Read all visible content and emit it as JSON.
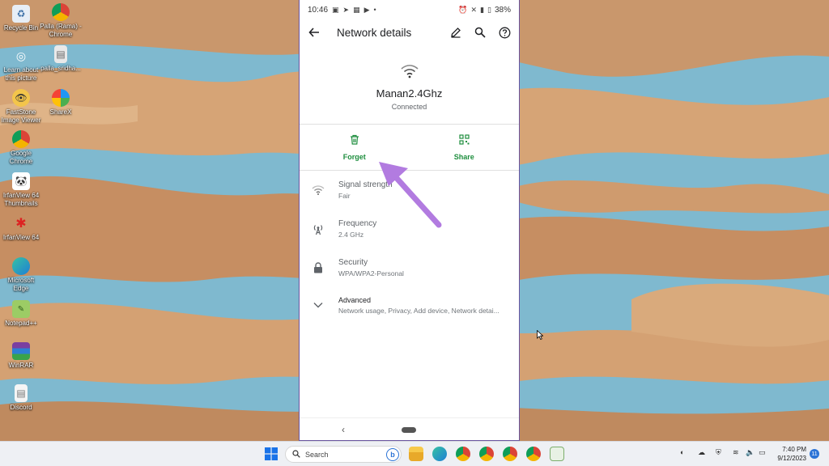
{
  "desktop": {
    "icons": [
      {
        "label": "Recycle Bin"
      },
      {
        "label": "Palla (Rama) - Chrome"
      },
      {
        "label": "Learn about this picture"
      },
      {
        "label": "palla_sridha..."
      },
      {
        "label": "FastStone Image Viewer"
      },
      {
        "label": "ShareX"
      },
      {
        "label": "Google Chrome"
      },
      {
        "label": "IrfanView 64 Thumbnails"
      },
      {
        "label": "IrfanView 64"
      },
      {
        "label": "Microsoft Edge"
      },
      {
        "label": "Notepad++"
      },
      {
        "label": "WinRAR"
      },
      {
        "label": "Discord"
      }
    ]
  },
  "phone": {
    "status_bar": {
      "time": "10:46",
      "battery": "38%"
    },
    "app_bar": {
      "title": "Network details"
    },
    "network": {
      "name": "Manan2.4Ghz",
      "status": "Connected"
    },
    "actions": {
      "forget": "Forget",
      "share": "Share"
    },
    "details": [
      {
        "label": "Signal strength",
        "value": "Fair"
      },
      {
        "label": "Frequency",
        "value": "2.4 GHz"
      },
      {
        "label": "Security",
        "value": "WPA/WPA2-Personal"
      },
      {
        "label": "Advanced",
        "value": "Network usage, Privacy, Add device, Network detai..."
      }
    ]
  },
  "taskbar": {
    "search_placeholder": "Search",
    "clock": {
      "time": "7:40 PM",
      "date": "9/12/2023"
    },
    "notifications": "11"
  },
  "colors": {
    "accent_green": "#1e8e3e",
    "annotation_arrow": "#b27be0"
  }
}
